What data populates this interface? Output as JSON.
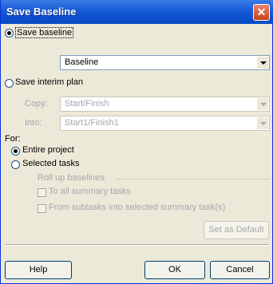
{
  "dialog": {
    "title": "Save Baseline",
    "close_label": "✕"
  },
  "save_baseline": {
    "label": "Save baseline",
    "value": "Baseline"
  },
  "save_interim": {
    "label": "Save interim plan"
  },
  "copy": {
    "label": "Copy:",
    "value": "Start/Finish"
  },
  "into": {
    "label": "Into:",
    "value": "Start1/Finish1"
  },
  "for": {
    "label": "For:"
  },
  "entire_project": {
    "label": "Entire project"
  },
  "selected_tasks": {
    "label": "Selected tasks"
  },
  "rollup": {
    "label": "Roll up baselines:"
  },
  "to_summary": {
    "label": "To all summary tasks"
  },
  "from_subtasks": {
    "label": "From subtasks into selected summary task(s)"
  },
  "buttons": {
    "set_default": "Set as Default",
    "help": "Help",
    "ok": "OK",
    "cancel": "Cancel"
  }
}
